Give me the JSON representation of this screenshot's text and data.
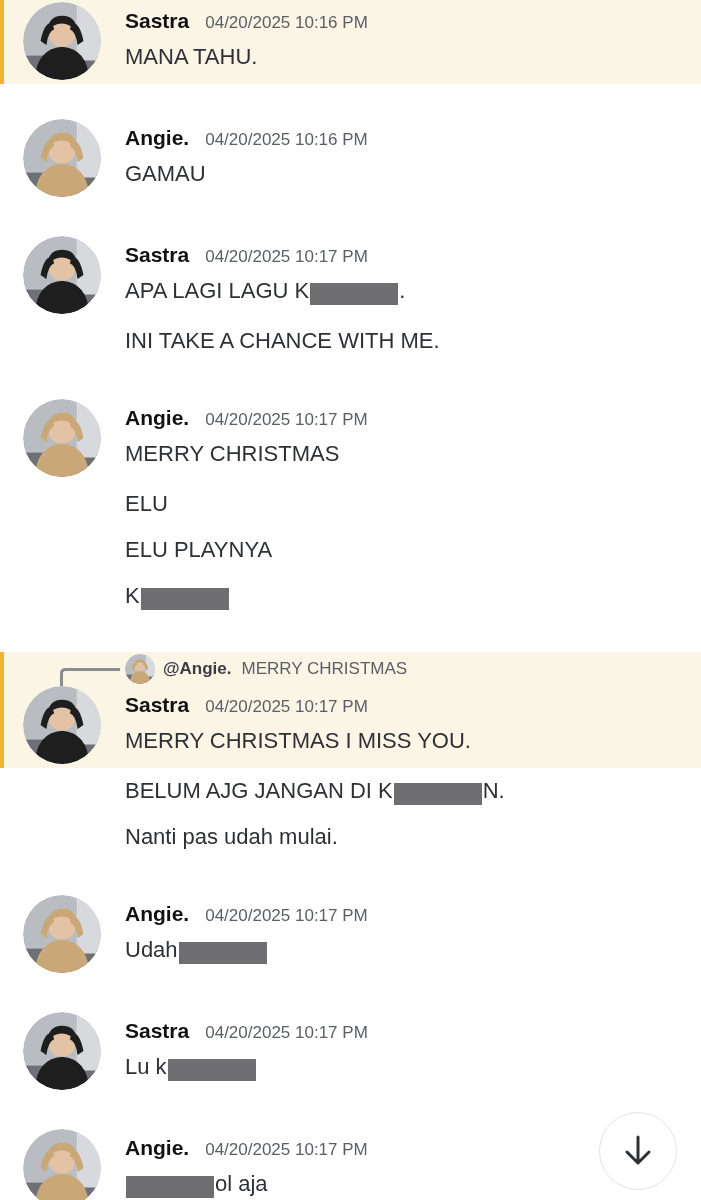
{
  "messages": [
    {
      "author": "Sastra",
      "time": "04/20/2025 10:16 PM",
      "highlighted": true,
      "avatar": {
        "kind": "picture",
        "color": "#1e1e1e"
      },
      "lines": [
        [
          {
            "kind": "text",
            "text": "MANA TAHU."
          }
        ]
      ]
    },
    {
      "author": "Angie.",
      "time": "04/20/2025 10:16 PM",
      "highlighted": false,
      "avatar": {
        "kind": "picture",
        "color": "#c9a777"
      },
      "lines": [
        [
          {
            "kind": "text",
            "text": "GAMAU"
          }
        ]
      ]
    },
    {
      "author": "Sastra",
      "time": "04/20/2025 10:17 PM",
      "highlighted": false,
      "avatar": {
        "kind": "picture",
        "color": "#1e1e1e"
      },
      "lines": [
        [
          {
            "kind": "text",
            "text": "APA LAGI LAGU K"
          },
          {
            "kind": "redaction"
          },
          {
            "kind": "text",
            "text": "."
          }
        ],
        [
          {
            "kind": "text",
            "text": "INI TAKE A CHANCE WITH ME."
          }
        ]
      ]
    },
    {
      "author": "Angie.",
      "time": "04/20/2025 10:17 PM",
      "highlighted": false,
      "avatar": {
        "kind": "picture",
        "color": "#c9a777"
      },
      "lines": [
        [
          {
            "kind": "text",
            "text": "MERRY CHRISTMAS"
          }
        ],
        [
          {
            "kind": "text",
            "text": "ELU"
          }
        ],
        [
          {
            "kind": "text",
            "text": "ELU PLAYNYA"
          }
        ],
        [
          {
            "kind": "text",
            "text": "K"
          },
          {
            "kind": "redaction"
          }
        ]
      ]
    },
    {
      "author": "Sastra",
      "time": "04/20/2025 10:17 PM",
      "highlighted": true,
      "avatar": {
        "kind": "picture",
        "color": "#1e1e1e"
      },
      "reply": {
        "avatar": {
          "kind": "picture",
          "color": "#c9a777"
        },
        "mention": "@Angie.",
        "text": "MERRY CHRISTMAS"
      },
      "lines": [
        [
          {
            "kind": "text",
            "text": "MERRY CHRISTMAS I MISS YOU."
          }
        ],
        [
          {
            "kind": "text",
            "text": "BELUM AJG JANGAN DI K"
          },
          {
            "kind": "redaction"
          },
          {
            "kind": "text",
            "text": "N."
          }
        ],
        [
          {
            "kind": "text",
            "text": "Nanti pas udah mulai."
          }
        ]
      ]
    },
    {
      "author": "Angie.",
      "time": "04/20/2025 10:17 PM",
      "highlighted": false,
      "avatar": {
        "kind": "picture",
        "color": "#c9a777"
      },
      "lines": [
        [
          {
            "kind": "text",
            "text": "Udah"
          },
          {
            "kind": "redaction"
          }
        ]
      ]
    },
    {
      "author": "Sastra",
      "time": "04/20/2025 10:17 PM",
      "highlighted": false,
      "avatar": {
        "kind": "picture",
        "color": "#1e1e1e"
      },
      "lines": [
        [
          {
            "kind": "text",
            "text": "Lu k"
          },
          {
            "kind": "redaction"
          }
        ]
      ]
    },
    {
      "author": "Angie.",
      "time": "04/20/2025 10:17 PM",
      "highlighted": false,
      "avatar": {
        "kind": "picture",
        "color": "#c9a777"
      },
      "lines": [
        [
          {
            "kind": "redaction"
          },
          {
            "kind": "text",
            "text": "ol aja"
          }
        ]
      ]
    }
  ]
}
